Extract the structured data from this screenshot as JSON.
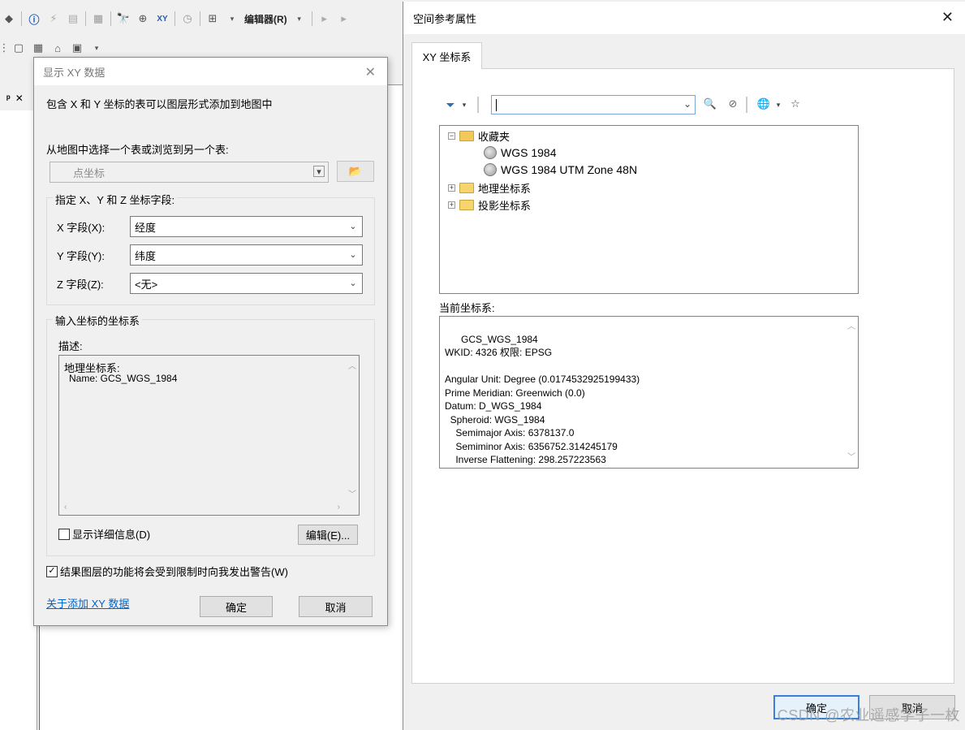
{
  "app": {
    "editor_menu": "编辑器(R)",
    "toc_pin": "ᵖ ✕"
  },
  "xy_dialog": {
    "title": "显示 XY 数据",
    "intro": "包含 X 和 Y 坐标的表可以图层形式添加到地图中",
    "choose_table_label": "从地图中选择一个表或浏览到另一个表:",
    "table_value": "点坐标",
    "fields_group_title": "指定 X、Y 和 Z 坐标字段:",
    "x_label": "X 字段(X):",
    "x_value": "经度",
    "y_label": "Y 字段(Y):",
    "y_value": "纬度",
    "z_label": "Z 字段(Z):",
    "z_value": "<无>",
    "cs_group_title": "输入坐标的坐标系",
    "desc_label": "描述:",
    "desc_line1": "地理坐标系:",
    "desc_line2": "Name: GCS_WGS_1984",
    "show_details_label": "显示详细信息(D)",
    "edit_button": "编辑(E)...",
    "warn_label": "结果图层的功能将会受到限制时向我发出警告(W)",
    "about_link": "关于添加 XY 数据",
    "ok_button": "确定",
    "cancel_button": "取消"
  },
  "sr_dialog": {
    "title": "空间参考属性",
    "tab_label": "XY 坐标系",
    "search_value": "",
    "tree": {
      "favorites": "收藏夹",
      "wgs1984": "WGS 1984",
      "utm48n": "WGS 1984 UTM Zone 48N",
      "geographic": "地理坐标系",
      "projected": "投影坐标系"
    },
    "current_cs_label": "当前坐标系:",
    "current_cs_text": "GCS_WGS_1984\nWKID: 4326 权限: EPSG\n\nAngular Unit: Degree (0.0174532925199433)\nPrime Meridian: Greenwich (0.0)\nDatum: D_WGS_1984\n  Spheroid: WGS_1984\n    Semimajor Axis: 6378137.0\n    Semiminor Axis: 6356752.314245179\n    Inverse Flattening: 298.257223563",
    "ok_button": "确定",
    "cancel_button": "取消"
  },
  "watermark": "CSDN @农业遥感学子一枚"
}
